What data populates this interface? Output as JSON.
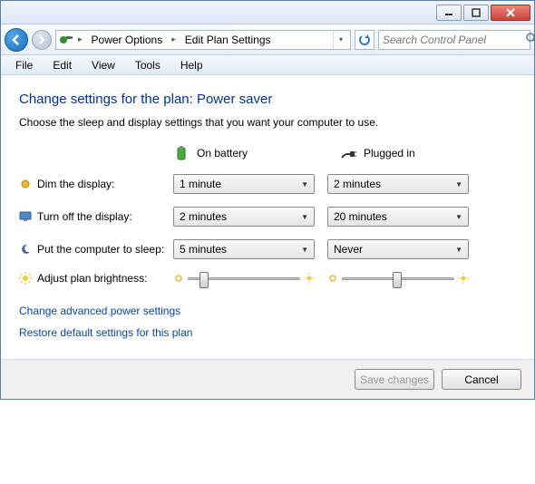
{
  "breadcrumb": {
    "item1": "Power Options",
    "item2": "Edit Plan Settings"
  },
  "search": {
    "placeholder": "Search Control Panel"
  },
  "menu": {
    "file": "File",
    "edit": "Edit",
    "view": "View",
    "tools": "Tools",
    "help": "Help"
  },
  "page": {
    "heading": "Change settings for the plan: Power saver",
    "subtext": "Choose the sleep and display settings that you want your computer to use.",
    "col_battery": "On battery",
    "col_plugged": "Plugged in"
  },
  "rows": {
    "dim": {
      "label": "Dim the display:",
      "battery": "1 minute",
      "plugged": "2 minutes"
    },
    "turnoff": {
      "label": "Turn off the display:",
      "battery": "2 minutes",
      "plugged": "20 minutes"
    },
    "sleep": {
      "label": "Put the computer to sleep:",
      "battery": "5 minutes",
      "plugged": "Never"
    },
    "brightness": {
      "label": "Adjust plan brightness:"
    }
  },
  "links": {
    "advanced": "Change advanced power settings",
    "restore": "Restore default settings for this plan"
  },
  "buttons": {
    "save": "Save changes",
    "cancel": "Cancel"
  },
  "slider": {
    "battery_pct": 10,
    "plugged_pct": 45
  },
  "colors": {
    "link": "#0645ad",
    "heading": "#003399"
  }
}
